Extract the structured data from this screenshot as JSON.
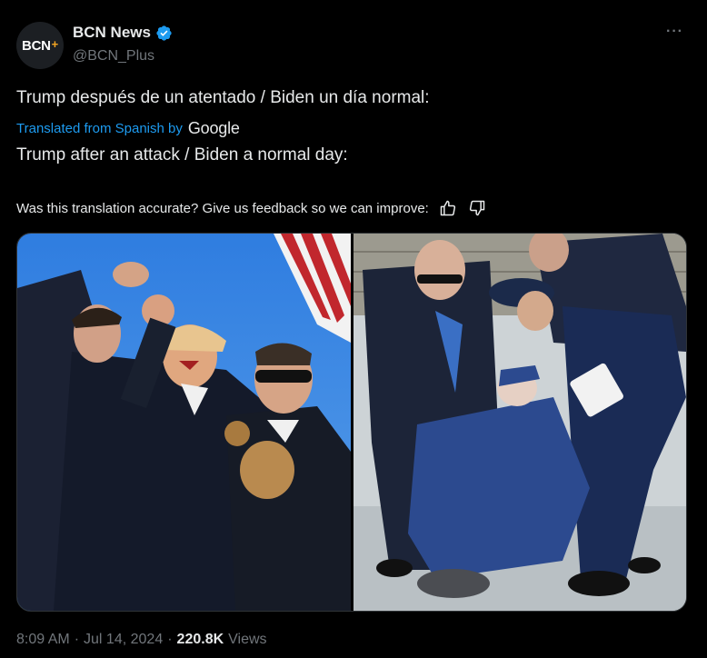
{
  "author": {
    "avatar_text": "BCN",
    "avatar_plus": "+",
    "display_name": "BCN News",
    "handle": "@BCN_Plus"
  },
  "more_label": "···",
  "tweet": {
    "original_text": "Trump después de un atentado / Biden un día normal:",
    "translated_from": "Translated from Spanish by",
    "translator": "Google",
    "translated_text": "Trump after an attack / Biden a normal day:",
    "feedback_prompt": "Was this translation accurate? Give us feedback so we can improve:"
  },
  "meta": {
    "time": "8:09 AM",
    "sep1": "·",
    "date": "Jul 14, 2024",
    "sep2": "·",
    "views_count": "220.8K",
    "views_label": "Views"
  },
  "colors": {
    "background": "#000000",
    "text": "#e7e9ea",
    "secondary": "#71767b",
    "link": "#1d9bf0",
    "verified": "#1d9bf0"
  },
  "icons": {
    "verified": "verified-badge-icon",
    "thumbs_up": "thumbs-up-icon",
    "thumbs_down": "thumbs-down-icon",
    "more": "more-dots-icon"
  }
}
